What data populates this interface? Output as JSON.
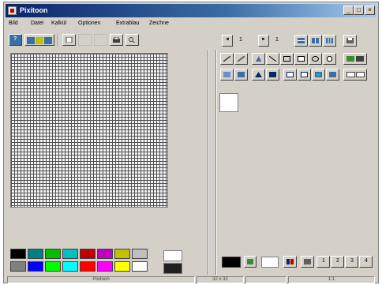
{
  "window": {
    "title": "Pixitoon",
    "controls": {
      "minimize": "_",
      "maximize": "□",
      "close": "×"
    }
  },
  "menu": [
    "Bild",
    "Datei",
    "Kalkül",
    "Optionen",
    "Extrablau",
    "Zeichne"
  ],
  "toolbar": {
    "help": "?",
    "left_group": [
      "open-color-icon",
      "save-color-icon",
      "blank-icon",
      "blank-icon",
      "blank-icon",
      "print-icon",
      "magnifier-icon"
    ],
    "nav": {
      "prev": "◄",
      "first_value": "1",
      "next": "►",
      "second_value": "1"
    }
  },
  "tools_right": {
    "row1": [
      "pencil-icon",
      "brush-icon",
      "fill-icon",
      "line-icon",
      "rectangle-icon",
      "rectangle-outline-icon",
      "ellipse-icon",
      "circle-icon"
    ],
    "row2": [
      "select-icon",
      "fill-bucket-icon",
      "stamp-icon",
      "copy-icon",
      "paste-icon",
      "flip-icon",
      "mirror-icon"
    ]
  },
  "palette": {
    "row1": [
      "#000000",
      "#008080",
      "#00c000",
      "#00c0c0",
      "#c00000",
      "#c000c0",
      "#c0c000",
      "#c0c0c0"
    ],
    "row2": [
      "#808080",
      "#0000ff",
      "#00ff00",
      "#00ffff",
      "#ff0000",
      "#ff00ff",
      "#ffff00",
      "#ffffff"
    ]
  },
  "right_bottom": {
    "current_color": "#000000",
    "buttons": [
      "1",
      "2",
      "3",
      "4"
    ]
  },
  "status": {
    "cell1": "Pixitoon",
    "cell2": "32 x 32",
    "cell3": "1:1"
  }
}
